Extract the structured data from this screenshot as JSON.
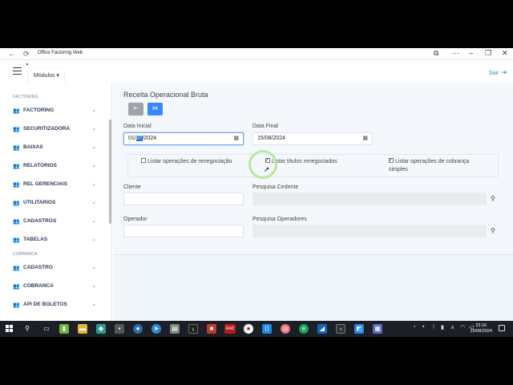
{
  "window": {
    "title": "Office Factoring Web"
  },
  "header": {
    "modules_label": "Módulos ▾",
    "logout_label": "Sair"
  },
  "sidebar": {
    "sections": [
      {
        "title": "FACTORING",
        "items": [
          "FACTORING",
          "SECURITIZADORA",
          "BAIXAS",
          "RELATORIOS",
          "REL GERENCIAIS",
          "UTILITARIOS",
          "CADASTROS",
          "TABELAS"
        ]
      },
      {
        "title": "COBRANCA",
        "items": [
          "CADASTRO",
          "COBRANCA",
          "API DE BOLETOS"
        ]
      }
    ]
  },
  "main": {
    "title": "Receita Operacional Bruta",
    "data_inicial_label": "Data Inicial",
    "data_inicial_before": "01/",
    "data_inicial_selected": "07",
    "data_inicial_after": "/2024",
    "data_final_label": "Data Final",
    "data_final_value": "15/08/2024",
    "check_renegociacao": "Listar operações de renegociação",
    "check_titulos": "Listar títulos renegociados",
    "check_cobranca_line1": "Listar operações de cobrança",
    "check_cobranca_line2": "simples",
    "cliente_label": "Cliente",
    "pesquisa_cedente_label": "Pesquisa Cedente",
    "operador_label": "Operador",
    "pesquisa_operadores_label": "Pesquisa Operadores"
  },
  "checkbox_states": {
    "renegociacao": false,
    "titulos": true,
    "cobranca": true
  },
  "taskbar": {
    "time": "23:16",
    "date": "15/08/2024",
    "rad_label": "RAD"
  },
  "colors": {
    "accent": "#3a86ff",
    "sidebar_text": "#2e3b5e",
    "main_bg": "#f1f6fb",
    "logout": "#3c8dbc"
  }
}
